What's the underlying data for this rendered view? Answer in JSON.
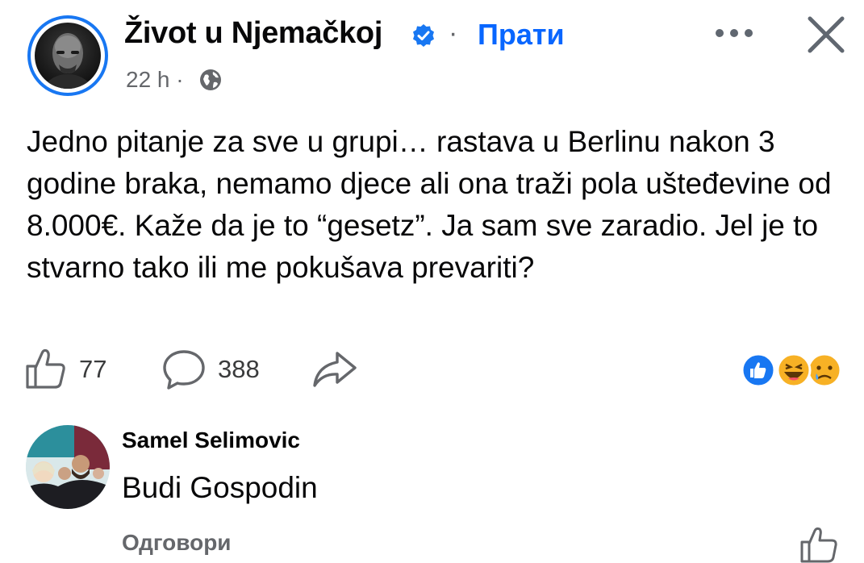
{
  "post": {
    "page_name": "Život u Njemačkoj",
    "separator": "·",
    "follow_label": "Прати",
    "time": "22 h ·",
    "text": "Jedno pitanje za sve u grupi… rastava u Berlinu nakon 3 godine braka, nemamo djece ali ona traži pola uštеđevine od 8.000€. Kaže da je to “gesetz”. Ja sam sve zaradio. Jel je to stvarno tako ili me pokušava prevariti?",
    "likes": "77",
    "comments": "388",
    "reactions": [
      "like-reaction-icon",
      "haha-reaction-icon",
      "sad-reaction-icon"
    ]
  },
  "comment": {
    "author": "Samel Selimovic",
    "text": "Budi Gospodin",
    "reply_label": "Одговори"
  },
  "colors": {
    "accent": "#0866ff",
    "secondary_text": "#65676b",
    "verified": "#1877f2"
  }
}
